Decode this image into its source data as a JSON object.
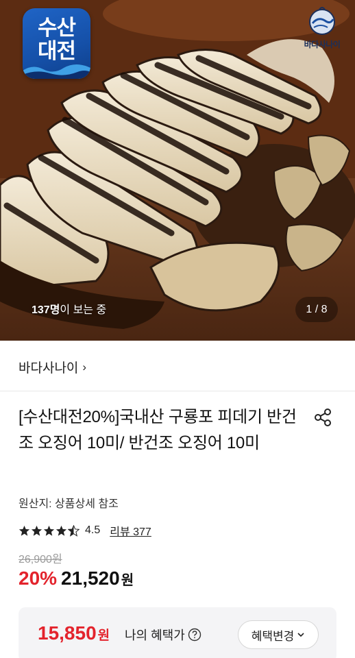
{
  "hero": {
    "badge_line1": "수산",
    "badge_line2": "대전",
    "brand_logo_text": "바다사나이",
    "viewers_count": "137명",
    "viewers_suffix": "이 보는 중",
    "pager": "1 / 8",
    "pager_current": 1,
    "pager_total": 8
  },
  "seller": {
    "name": "바다사나이",
    "chevron": "›"
  },
  "product": {
    "title": "[수산대전20%]국내산 구룡포 피데기 반건조 오징어 10미/ 반건조 오징어 10미",
    "origin": "원산지: 상품상세 참조",
    "rating": {
      "score": "4.5",
      "stars": 4.5,
      "review_label": "리뷰 377"
    },
    "original_price": "26,900원",
    "discount": "20%",
    "price": "21,520",
    "price_unit": "원"
  },
  "benefit": {
    "price": "15,850",
    "price_unit": "원",
    "label": "나의 혜택가",
    "button_label": "혜택변경"
  },
  "colors": {
    "accent_red": "#e3232c",
    "badge_blue": "#1550a8"
  },
  "icons": {
    "share": "share-icon",
    "help": "help-circle-icon",
    "chevron_down": "chevron-down-icon",
    "chevron_right": "chevron-right-icon",
    "star": "star-icon"
  }
}
